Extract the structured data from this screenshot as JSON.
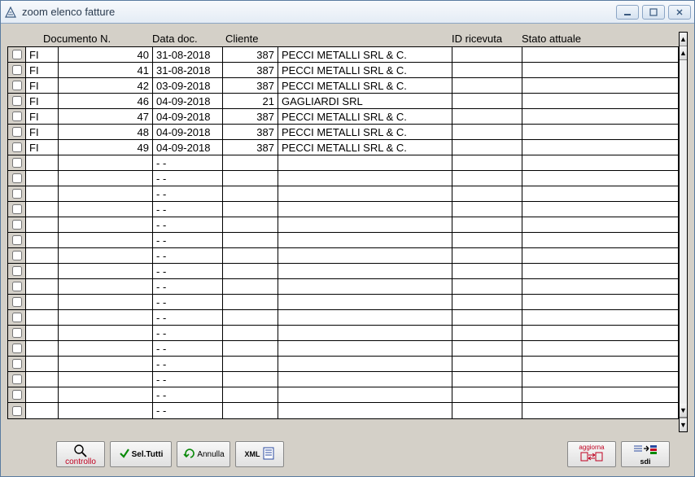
{
  "window": {
    "title": "zoom elenco fatture"
  },
  "columns": {
    "chk": "",
    "documento": "Documento N.",
    "data": "Data doc.",
    "cliente": "Cliente",
    "id_ricevuta": "ID ricevuta",
    "stato": "Stato attuale"
  },
  "rows": [
    {
      "chk": false,
      "tipo": "FI",
      "num": "40",
      "data": "31-08-2018",
      "cliCode": "387",
      "cliName": "PECCI METALLI SRL & C.",
      "idr": "",
      "stato": ""
    },
    {
      "chk": false,
      "tipo": "FI",
      "num": "41",
      "data": "31-08-2018",
      "cliCode": "387",
      "cliName": "PECCI METALLI SRL & C.",
      "idr": "",
      "stato": ""
    },
    {
      "chk": false,
      "tipo": "FI",
      "num": "42",
      "data": "03-09-2018",
      "cliCode": "387",
      "cliName": "PECCI METALLI SRL & C.",
      "idr": "",
      "stato": ""
    },
    {
      "chk": false,
      "tipo": "FI",
      "num": "46",
      "data": "04-09-2018",
      "cliCode": "21",
      "cliName": "GAGLIARDI SRL",
      "idr": "",
      "stato": ""
    },
    {
      "chk": false,
      "tipo": "FI",
      "num": "47",
      "data": "04-09-2018",
      "cliCode": "387",
      "cliName": "PECCI METALLI SRL & C.",
      "idr": "",
      "stato": ""
    },
    {
      "chk": false,
      "tipo": "FI",
      "num": "48",
      "data": "04-09-2018",
      "cliCode": "387",
      "cliName": "PECCI METALLI SRL & C.",
      "idr": "",
      "stato": ""
    },
    {
      "chk": false,
      "tipo": "FI",
      "num": "49",
      "data": "04-09-2018",
      "cliCode": "387",
      "cliName": "PECCI METALLI SRL & C.",
      "idr": "",
      "stato": ""
    },
    {
      "chk": false,
      "tipo": "",
      "num": "",
      "data": "  -  -",
      "cliCode": "",
      "cliName": "",
      "idr": "",
      "stato": ""
    },
    {
      "chk": false,
      "tipo": "",
      "num": "",
      "data": "  -  -",
      "cliCode": "",
      "cliName": "",
      "idr": "",
      "stato": ""
    },
    {
      "chk": false,
      "tipo": "",
      "num": "",
      "data": "  -  -",
      "cliCode": "",
      "cliName": "",
      "idr": "",
      "stato": ""
    },
    {
      "chk": false,
      "tipo": "",
      "num": "",
      "data": "  -  -",
      "cliCode": "",
      "cliName": "",
      "idr": "",
      "stato": ""
    },
    {
      "chk": false,
      "tipo": "",
      "num": "",
      "data": "  -  -",
      "cliCode": "",
      "cliName": "",
      "idr": "",
      "stato": ""
    },
    {
      "chk": false,
      "tipo": "",
      "num": "",
      "data": "  -  -",
      "cliCode": "",
      "cliName": "",
      "idr": "",
      "stato": ""
    },
    {
      "chk": false,
      "tipo": "",
      "num": "",
      "data": "  -  -",
      "cliCode": "",
      "cliName": "",
      "idr": "",
      "stato": ""
    },
    {
      "chk": false,
      "tipo": "",
      "num": "",
      "data": "  -  -",
      "cliCode": "",
      "cliName": "",
      "idr": "",
      "stato": ""
    },
    {
      "chk": false,
      "tipo": "",
      "num": "",
      "data": "  -  -",
      "cliCode": "",
      "cliName": "",
      "idr": "",
      "stato": ""
    },
    {
      "chk": false,
      "tipo": "",
      "num": "",
      "data": "  -  -",
      "cliCode": "",
      "cliName": "",
      "idr": "",
      "stato": ""
    },
    {
      "chk": false,
      "tipo": "",
      "num": "",
      "data": "  -  -",
      "cliCode": "",
      "cliName": "",
      "idr": "",
      "stato": ""
    },
    {
      "chk": false,
      "tipo": "",
      "num": "",
      "data": "  -  -",
      "cliCode": "",
      "cliName": "",
      "idr": "",
      "stato": ""
    },
    {
      "chk": false,
      "tipo": "",
      "num": "",
      "data": "  -  -",
      "cliCode": "",
      "cliName": "",
      "idr": "",
      "stato": ""
    },
    {
      "chk": false,
      "tipo": "",
      "num": "",
      "data": "  -  -",
      "cliCode": "",
      "cliName": "",
      "idr": "",
      "stato": ""
    },
    {
      "chk": false,
      "tipo": "",
      "num": "",
      "data": "  -  -",
      "cliCode": "",
      "cliName": "",
      "idr": "",
      "stato": ""
    },
    {
      "chk": false,
      "tipo": "",
      "num": "",
      "data": "  -  -",
      "cliCode": "",
      "cliName": "",
      "idr": "",
      "stato": ""
    },
    {
      "chk": false,
      "tipo": "",
      "num": "",
      "data": "  -  -",
      "cliCode": "",
      "cliName": "",
      "idr": "",
      "stato": ""
    }
  ],
  "toolbar": {
    "controllo": "controllo",
    "sel_tutti": "Sel.Tutti",
    "annulla": "Annulla",
    "xml": "XML",
    "aggiorna": "aggiorna",
    "sdi": "sdi"
  }
}
